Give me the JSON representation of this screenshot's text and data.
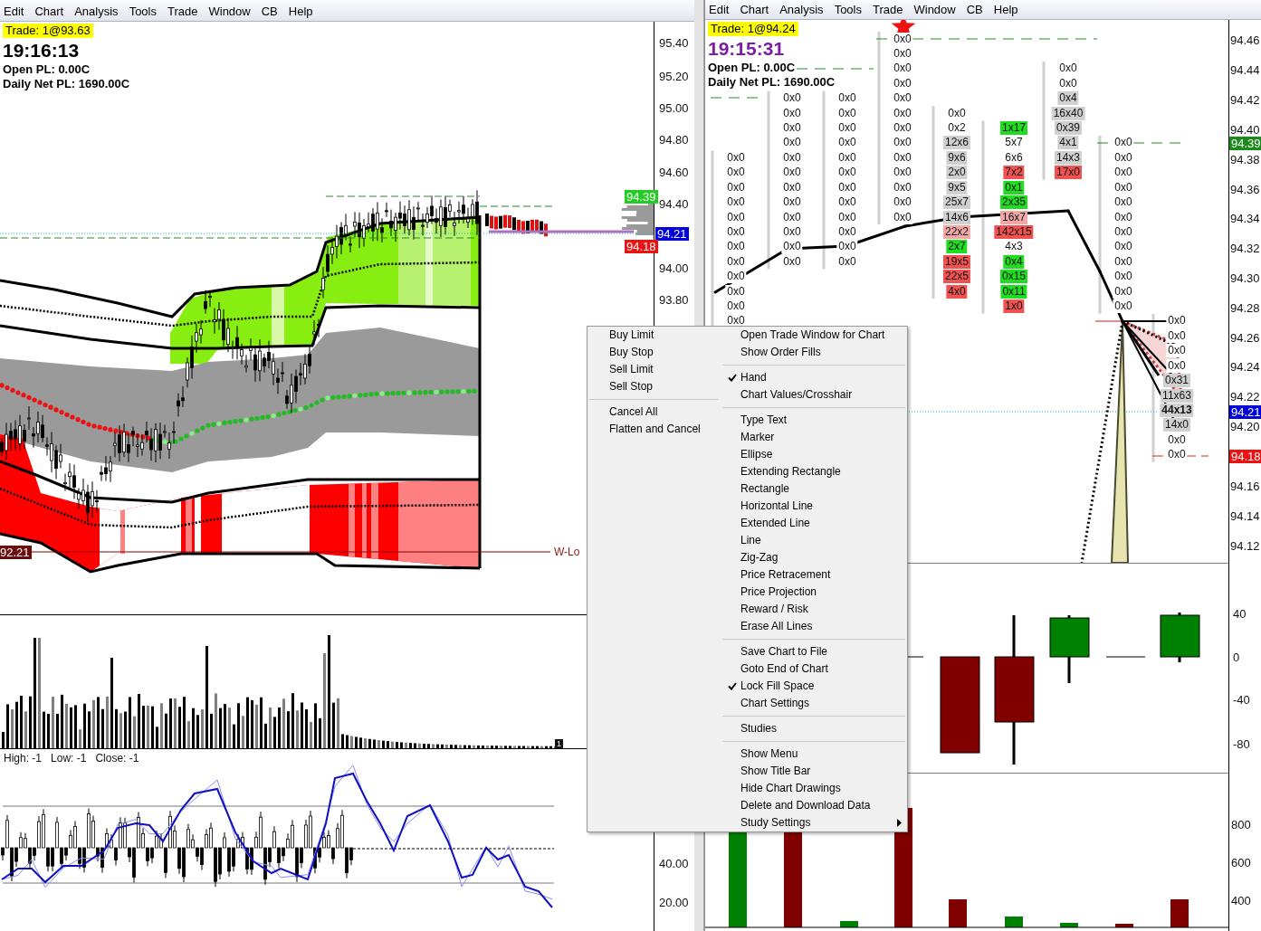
{
  "left_window": {
    "menu": [
      "Edit",
      "Chart",
      "Analysis",
      "Tools",
      "Trade",
      "Window",
      "CB",
      "Help"
    ],
    "trade": "Trade: 1@93.63",
    "time": "19:16:13",
    "open_pl": "Open PL: 0.00C",
    "daily_pl": "Daily Net PL: 1690.00C",
    "price_axis": [
      {
        "kind": "tick",
        "text": "95.40"
      },
      {
        "kind": "tick",
        "text": "95.20"
      },
      {
        "kind": "tick",
        "text": "95.00"
      },
      {
        "kind": "tick",
        "text": "94.80"
      },
      {
        "kind": "tick",
        "text": "94.60"
      },
      {
        "kind": "badge",
        "text": "94.39",
        "color": "#22cc22"
      },
      {
        "kind": "tick",
        "text": "94.40"
      },
      {
        "kind": "badge",
        "text": "94.21",
        "color": "#0000dd"
      },
      {
        "kind": "badge",
        "text": "94.18",
        "color": "#ee1111"
      },
      {
        "kind": "tick",
        "text": "94.00"
      },
      {
        "kind": "tick",
        "text": "93.80"
      }
    ],
    "low_badge": "92.21",
    "low_label": "W-Lo",
    "volume_marker": "1",
    "oscillator_legend": [
      "High: -1",
      "Low: -1",
      "Close: -1"
    ],
    "oscillator_axis": [
      "40.00",
      "20.00"
    ]
  },
  "right_window": {
    "menu": [
      "Edit",
      "Chart",
      "Analysis",
      "Tools",
      "Trade",
      "Window",
      "CB",
      "Help"
    ],
    "trade": "Trade: 1@94.24",
    "time": "19:15:31",
    "open_pl": "Open PL: 0.00C",
    "daily_pl": "Daily Net PL: 1690.00C",
    "price_axis": [
      {
        "kind": "tick",
        "text": "94.46"
      },
      {
        "kind": "tick",
        "text": "94.44"
      },
      {
        "kind": "tick",
        "text": "94.42"
      },
      {
        "kind": "tick",
        "text": "94.40"
      },
      {
        "kind": "badge",
        "text": "94.39",
        "color": "#1a8a1a"
      },
      {
        "kind": "tick",
        "text": "94.38"
      },
      {
        "kind": "tick",
        "text": "94.36"
      },
      {
        "kind": "tick",
        "text": "94.34"
      },
      {
        "kind": "tick",
        "text": "94.32"
      },
      {
        "kind": "tick",
        "text": "94.30"
      },
      {
        "kind": "tick",
        "text": "94.28"
      },
      {
        "kind": "tick",
        "text": "94.26"
      },
      {
        "kind": "tick",
        "text": "94.24"
      },
      {
        "kind": "tick",
        "text": "94.22"
      },
      {
        "kind": "badge",
        "text": "94.21",
        "color": "#0000dd"
      },
      {
        "kind": "tick",
        "text": "94.20"
      },
      {
        "kind": "badge",
        "text": "94.18",
        "color": "#ee1111"
      },
      {
        "kind": "tick",
        "text": "94.16"
      },
      {
        "kind": "tick",
        "text": "94.14"
      },
      {
        "kind": "tick",
        "text": "94.12"
      }
    ],
    "order_book": {
      "columns": [
        [
          {
            "kind": "plain",
            "text": "0x0"
          },
          {
            "kind": "plain",
            "text": "0x0"
          },
          {
            "kind": "plain",
            "text": "0x0"
          },
          {
            "kind": "plain",
            "text": "0x0"
          },
          {
            "kind": "plain",
            "text": "0x0"
          },
          {
            "kind": "plain",
            "text": "0x0"
          },
          {
            "kind": "plain",
            "text": "0x0"
          },
          {
            "kind": "plain",
            "text": "0x0"
          },
          {
            "kind": "plain",
            "text": "0x0"
          },
          {
            "kind": "plain",
            "text": "0x0"
          },
          {
            "kind": "plain",
            "text": "0x0"
          },
          {
            "kind": "plain",
            "text": "0x0"
          }
        ],
        [
          {
            "kind": "plain",
            "text": "0x0"
          },
          {
            "kind": "plain",
            "text": "0x0"
          },
          {
            "kind": "plain",
            "text": "0x0"
          },
          {
            "kind": "plain",
            "text": "0x0"
          },
          {
            "kind": "plain",
            "text": "0x0"
          },
          {
            "kind": "plain",
            "text": "0x0"
          },
          {
            "kind": "plain",
            "text": "0x0"
          },
          {
            "kind": "plain",
            "text": "0x0"
          },
          {
            "kind": "plain",
            "text": "0x0"
          },
          {
            "kind": "plain",
            "text": "0x0"
          },
          {
            "kind": "plain",
            "text": "0x0"
          },
          {
            "kind": "plain",
            "text": "0x0"
          }
        ],
        [
          {
            "kind": "plain",
            "text": "0x0"
          },
          {
            "kind": "plain",
            "text": "0x0"
          },
          {
            "kind": "plain",
            "text": "0x0"
          },
          {
            "kind": "plain",
            "text": "0x0"
          },
          {
            "kind": "plain",
            "text": "0x0"
          },
          {
            "kind": "plain",
            "text": "0x0"
          },
          {
            "kind": "plain",
            "text": "0x0"
          },
          {
            "kind": "plain",
            "text": "0x0"
          },
          {
            "kind": "plain",
            "text": "0x0"
          },
          {
            "kind": "plain",
            "text": "0x0"
          },
          {
            "kind": "plain",
            "text": "0x0"
          },
          {
            "kind": "plain",
            "text": "0x0"
          }
        ],
        [
          {
            "kind": "plain",
            "text": "0x0"
          },
          {
            "kind": "plain",
            "text": "0x0"
          },
          {
            "kind": "plain",
            "text": "0x0"
          },
          {
            "kind": "plain",
            "text": "0x0"
          },
          {
            "kind": "plain",
            "text": "0x0"
          },
          {
            "kind": "plain",
            "text": "0x0"
          },
          {
            "kind": "plain",
            "text": "0x0"
          },
          {
            "kind": "plain",
            "text": "0x0"
          },
          {
            "kind": "plain",
            "text": "0x0"
          },
          {
            "kind": "plain",
            "text": "0x0"
          },
          {
            "kind": "plain",
            "text": "0x0"
          },
          {
            "kind": "plain",
            "text": "0x0"
          },
          {
            "kind": "plain",
            "text": "0x0"
          }
        ],
        [
          {
            "kind": "plain",
            "text": "0x0"
          },
          {
            "kind": "plain",
            "text": "0x2"
          },
          {
            "kind": "bar",
            "text": "12x6",
            "color": "#d0d0d0"
          },
          {
            "kind": "bar",
            "text": "9x6",
            "color": "#d0d0d0"
          },
          {
            "kind": "bar",
            "text": "2x0",
            "color": "#d0d0d0"
          },
          {
            "kind": "bar",
            "text": "9x5",
            "color": "#d0d0d0"
          },
          {
            "kind": "bar",
            "text": "25x7",
            "color": "#d0d0d0"
          },
          {
            "kind": "bar",
            "text": "14x6",
            "color": "#d0d0d0"
          },
          {
            "kind": "bar",
            "text": "22x2",
            "color": "#f4a7a7"
          },
          {
            "kind": "bar",
            "text": "2x7",
            "color": "#1fdd1f"
          },
          {
            "kind": "bar",
            "text": "19x5",
            "color": "#f05252"
          },
          {
            "kind": "bar",
            "text": "22x5",
            "color": "#f05252"
          },
          {
            "kind": "bar",
            "text": "4x0",
            "color": "#f05252"
          }
        ],
        [
          {
            "kind": "bar",
            "text": "1x17",
            "color": "#1fdd1f"
          },
          {
            "kind": "plain",
            "text": "5x7"
          },
          {
            "kind": "plain",
            "text": "6x6"
          },
          {
            "kind": "bar",
            "text": "7x2",
            "color": "#f05252"
          },
          {
            "kind": "bar",
            "text": "0x1",
            "color": "#1fdd1f"
          },
          {
            "kind": "bar",
            "text": "2x35",
            "color": "#1fdd1f"
          },
          {
            "kind": "bar",
            "text": "16x7",
            "color": "#f4a7a7"
          },
          {
            "kind": "bar",
            "text": "142x15",
            "color": "#f05252"
          },
          {
            "kind": "plain",
            "text": "4x3"
          },
          {
            "kind": "bar",
            "text": "0x4",
            "color": "#1fdd1f"
          },
          {
            "kind": "bar",
            "text": "0x15",
            "color": "#1fdd1f"
          },
          {
            "kind": "bar",
            "text": "0x11",
            "color": "#1fdd1f"
          },
          {
            "kind": "bar",
            "text": "1x0",
            "color": "#f05252"
          }
        ],
        [
          {
            "kind": "plain",
            "text": "0x0"
          },
          {
            "kind": "plain",
            "text": "0x0"
          },
          {
            "kind": "bar",
            "text": "0x4",
            "color": "#d0d0d0"
          },
          {
            "kind": "bar",
            "text": "16x40",
            "color": "#d0d0d0"
          },
          {
            "kind": "bar",
            "text": "0x39",
            "color": "#d0d0d0"
          },
          {
            "kind": "bar",
            "text": "4x1",
            "color": "#d0d0d0"
          },
          {
            "kind": "bar",
            "text": "14x3",
            "color": "#d0d0d0"
          },
          {
            "kind": "bar",
            "text": "17x0",
            "color": "#f05252"
          }
        ],
        [
          {
            "kind": "plain",
            "text": "0x0"
          },
          {
            "kind": "plain",
            "text": "0x0"
          },
          {
            "kind": "plain",
            "text": "0x0"
          },
          {
            "kind": "plain",
            "text": "0x0"
          },
          {
            "kind": "plain",
            "text": "0x0"
          },
          {
            "kind": "plain",
            "text": "0x0"
          },
          {
            "kind": "plain",
            "text": "0x0"
          },
          {
            "kind": "plain",
            "text": "0x0"
          },
          {
            "kind": "plain",
            "text": "0x0"
          },
          {
            "kind": "plain",
            "text": "0x0"
          },
          {
            "kind": "plain",
            "text": "0x0"
          },
          {
            "kind": "plain",
            "text": "0x0"
          }
        ],
        [
          {
            "kind": "plain",
            "text": "0x0"
          },
          {
            "kind": "plain",
            "text": "0x0"
          },
          {
            "kind": "plain",
            "text": "0x0"
          },
          {
            "kind": "plain",
            "text": "0x0"
          },
          {
            "kind": "bar",
            "text": "0x31",
            "color": "#d0d0d0"
          },
          {
            "kind": "bar",
            "text": "11x63",
            "color": "#d0d0d0"
          },
          {
            "kind": "last",
            "text": "44x13",
            "color": "#d0d0d0"
          },
          {
            "kind": "bar",
            "text": "14x0",
            "color": "#d0d0d0"
          },
          {
            "kind": "plain",
            "text": "0x0"
          },
          {
            "kind": "plain",
            "text": "0x0"
          }
        ]
      ]
    },
    "delta_axis": [
      "40",
      "0",
      "-40",
      "-80"
    ],
    "volume_axis": [
      "800",
      "600",
      "400"
    ]
  },
  "context_menu": {
    "left_groups": [
      [
        "Buy Limit",
        "Buy Stop",
        "Sell Limit",
        "Sell Stop"
      ],
      [
        "Cancel All",
        "Flatten and Cancel"
      ]
    ],
    "right_groups": [
      [
        {
          "label": "Open Trade Window for Chart",
          "checked": false,
          "submenu": false
        },
        {
          "label": "Show Order Fills",
          "checked": false,
          "submenu": false
        }
      ],
      [
        {
          "label": "Hand",
          "checked": true,
          "submenu": false
        },
        {
          "label": "Chart Values/Crosshair",
          "checked": false,
          "submenu": false
        }
      ],
      [
        {
          "label": "Type Text",
          "checked": false,
          "submenu": false
        },
        {
          "label": "Marker",
          "checked": false,
          "submenu": false
        },
        {
          "label": "Ellipse",
          "checked": false,
          "submenu": false
        },
        {
          "label": "Extending Rectangle",
          "checked": false,
          "submenu": false
        },
        {
          "label": "Rectangle",
          "checked": false,
          "submenu": false
        },
        {
          "label": "Horizontal Line",
          "checked": false,
          "submenu": false
        },
        {
          "label": "Extended Line",
          "checked": false,
          "submenu": false
        },
        {
          "label": "Line",
          "checked": false,
          "submenu": false
        },
        {
          "label": "Zig-Zag",
          "checked": false,
          "submenu": false
        },
        {
          "label": "Price Retracement",
          "checked": false,
          "submenu": false
        },
        {
          "label": "Price Projection",
          "checked": false,
          "submenu": false
        },
        {
          "label": "Reward / Risk",
          "checked": false,
          "submenu": false
        },
        {
          "label": "Erase All Lines",
          "checked": false,
          "submenu": false
        }
      ],
      [
        {
          "label": "Save Chart to File",
          "checked": false,
          "submenu": false
        },
        {
          "label": "Goto End of Chart",
          "checked": false,
          "submenu": false
        },
        {
          "label": "Lock Fill Space",
          "checked": true,
          "submenu": false
        },
        {
          "label": "Chart Settings",
          "checked": false,
          "submenu": false
        }
      ],
      [
        {
          "label": "Studies",
          "checked": false,
          "submenu": false
        }
      ],
      [
        {
          "label": "Show Menu",
          "checked": false,
          "submenu": false
        },
        {
          "label": "Show Title Bar",
          "checked": false,
          "submenu": false
        },
        {
          "label": "Hide Chart Drawings",
          "checked": false,
          "submenu": false
        },
        {
          "label": "Delete and Download Data",
          "checked": false,
          "submenu": false
        },
        {
          "label": "Study Settings",
          "checked": false,
          "submenu": true
        }
      ]
    ]
  }
}
